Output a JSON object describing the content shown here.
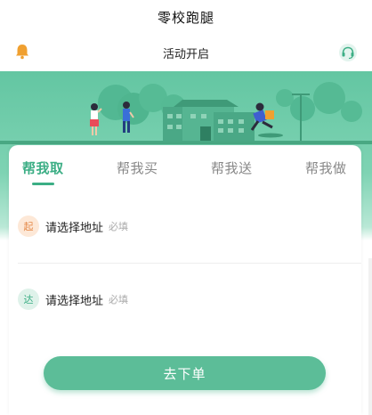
{
  "header": {
    "title": "零校跑腿"
  },
  "notice": {
    "text": "活动开启",
    "left_icon": "bell-icon",
    "right_icon": "customer-service-icon"
  },
  "tabs": [
    {
      "label": "帮我取",
      "active": true
    },
    {
      "label": "帮我买",
      "active": false
    },
    {
      "label": "帮我送",
      "active": false
    },
    {
      "label": "帮我做",
      "active": false
    }
  ],
  "form": {
    "start": {
      "badge": "起",
      "text": "请选择地址",
      "hint": "必填"
    },
    "end": {
      "badge": "达",
      "text": "请选择地址",
      "hint": "必填"
    }
  },
  "submit": {
    "label": "去下单"
  },
  "colors": {
    "accent": "#3cae85",
    "banner": "#63c6a2",
    "button": "#5cbd98",
    "bell": "#f0a030",
    "start_badge": "#e58a4a"
  }
}
